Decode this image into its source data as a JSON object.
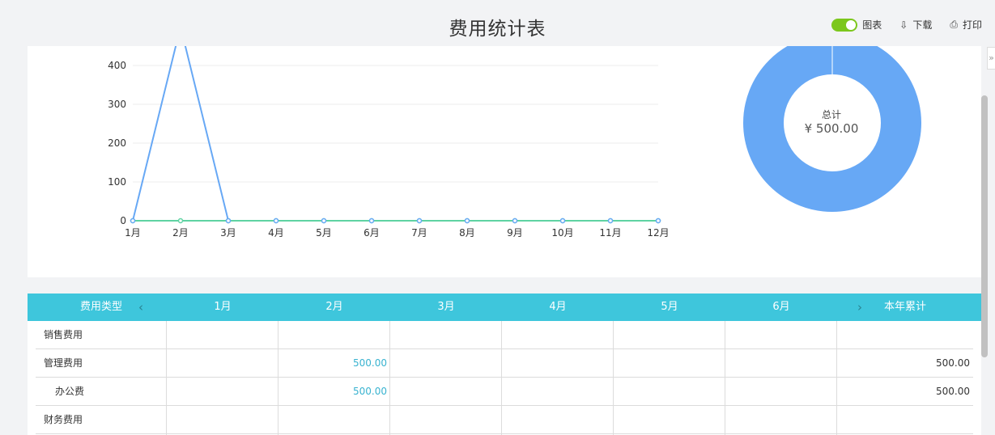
{
  "header": {
    "title": "费用统计表",
    "chart_toggle_label": "图表",
    "download_label": "下载",
    "print_label": "打印"
  },
  "donut": {
    "center_label": "总计",
    "center_value": "¥ 500.00",
    "color": "#67a8f5"
  },
  "chart_data": {
    "type": "line",
    "categories": [
      "1月",
      "2月",
      "3月",
      "4月",
      "5月",
      "6月",
      "7月",
      "8月",
      "9月",
      "10月",
      "11月",
      "12月"
    ],
    "y_ticks": [
      "0",
      "100",
      "200",
      "300",
      "400"
    ],
    "ylim": [
      0,
      500
    ],
    "series": [
      {
        "values": [
          0,
          500,
          0,
          0,
          0,
          0,
          0,
          0,
          0,
          0,
          0,
          0
        ],
        "color": "#67a8f5"
      },
      {
        "values": [
          0,
          0,
          0,
          0,
          0,
          0,
          0,
          0,
          0,
          0,
          0,
          0
        ],
        "color": "#5fd3a3"
      }
    ],
    "grid": true
  },
  "table": {
    "columns": [
      "费用类型",
      "1月",
      "2月",
      "3月",
      "4月",
      "5月",
      "6月",
      "本年累计"
    ],
    "rows": [
      {
        "type": "销售费用",
        "cells": [
          "",
          "",
          "",
          "",
          "",
          ""
        ],
        "total": ""
      },
      {
        "type": "管理费用",
        "cells": [
          "",
          "500.00",
          "",
          "",
          "",
          ""
        ],
        "total": "500.00"
      },
      {
        "type": "办公费",
        "cells": [
          "",
          "500.00",
          "",
          "",
          "",
          ""
        ],
        "total": "500.00"
      },
      {
        "type": "财务费用",
        "cells": [
          "",
          "",
          "",
          "",
          "",
          ""
        ],
        "total": ""
      }
    ]
  },
  "colors": {
    "accent_toggle": "#7cc71c",
    "table_header": "#3ec6dc",
    "link_value": "#39b3d0"
  }
}
